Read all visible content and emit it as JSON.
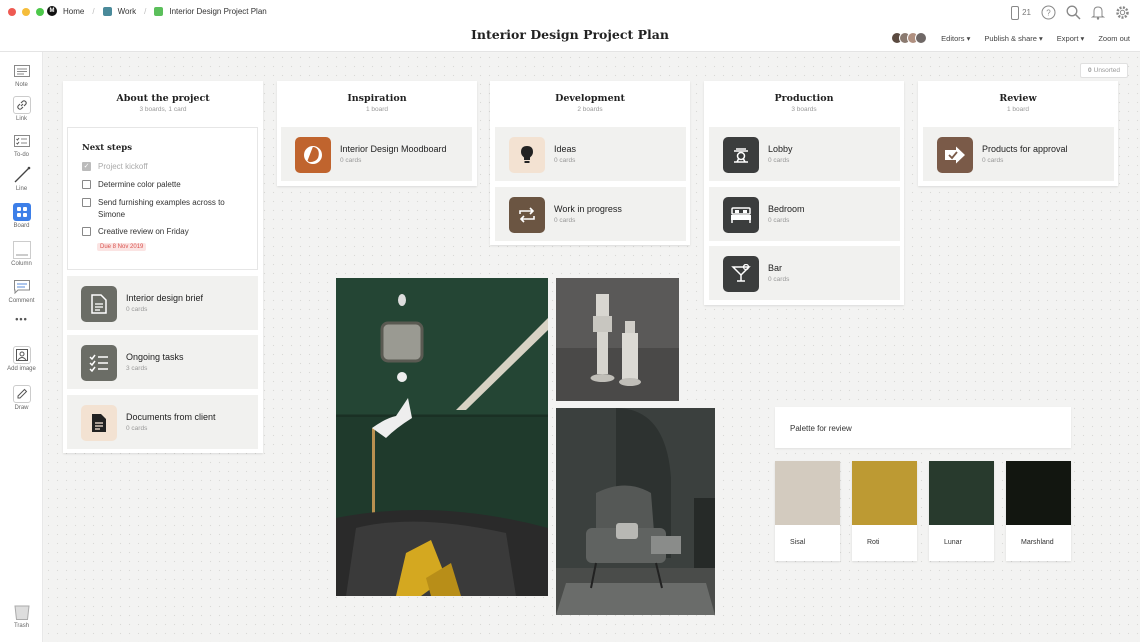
{
  "window": {
    "breadcrumbs": [
      {
        "label": "Home",
        "color": "#111111"
      },
      {
        "label": "Work",
        "color": "#4a8a9a"
      },
      {
        "label": "Interior Design Project Plan",
        "color": "#5bbf5b"
      }
    ],
    "title": "Interior Design Project Plan",
    "device_count": "21",
    "menu": {
      "editors": "Editors",
      "publish": "Publish & share",
      "export": "Export",
      "zoom": "Zoom out"
    }
  },
  "toolbar": {
    "note": "Note",
    "link": "Link",
    "todo": "To-do",
    "line": "Line",
    "board": "Board",
    "column": "Column",
    "comment": "Comment",
    "more": "•••",
    "add_image": "Add image",
    "draw": "Draw",
    "trash": "Trash"
  },
  "unsorted": {
    "count": "0",
    "label": "Unsorted"
  },
  "columns": {
    "about": {
      "title": "About the project",
      "subtitle": "3 boards, 1 card",
      "todo": {
        "title": "Next steps",
        "items": [
          {
            "text": "Project kickoff",
            "done": true
          },
          {
            "text": "Determine color palette",
            "done": false
          },
          {
            "text": "Send furnishing examples across to Simone",
            "done": false
          },
          {
            "text": "Creative review on Friday",
            "done": false
          }
        ],
        "due": "Due 8 Nov 2019"
      },
      "boards": [
        {
          "name": "Interior design brief",
          "count": "0 cards",
          "icon": "document-icon",
          "color": "#6b6d66"
        },
        {
          "name": "Ongoing tasks",
          "count": "3 cards",
          "icon": "checklist-icon",
          "color": "#6b6d66"
        },
        {
          "name": "Documents from client",
          "count": "0 cards",
          "icon": "file-text-icon",
          "color": "#f3e2d2"
        }
      ]
    },
    "inspiration": {
      "title": "Inspiration",
      "subtitle": "1 board",
      "boards": [
        {
          "name": "Interior Design Moodboard",
          "count": "0 cards",
          "icon": "moodboard-icon",
          "color": "#c0642e"
        }
      ]
    },
    "development": {
      "title": "Development",
      "subtitle": "2 boards",
      "boards": [
        {
          "name": "Ideas",
          "count": "0 cards",
          "icon": "lightbulb-icon",
          "color": "#f3e2d2"
        },
        {
          "name": "Work in progress",
          "count": "0 cards",
          "icon": "repeat-icon",
          "color": "#6b5542"
        }
      ]
    },
    "production": {
      "title": "Production",
      "subtitle": "3 boards",
      "boards": [
        {
          "name": "Lobby",
          "count": "0 cards",
          "icon": "lobby-icon",
          "color": "#3b3d3d"
        },
        {
          "name": "Bedroom",
          "count": "0 cards",
          "icon": "bed-icon",
          "color": "#3b3d3d"
        },
        {
          "name": "Bar",
          "count": "0 cards",
          "icon": "cocktail-icon",
          "color": "#3b3d3d"
        }
      ]
    },
    "review": {
      "title": "Review",
      "subtitle": "1 board",
      "boards": [
        {
          "name": "Products for approval",
          "count": "0 cards",
          "icon": "approve-arrow-icon",
          "color": "#7a5a48"
        }
      ]
    }
  },
  "palette": {
    "title": "Palette for review",
    "swatches": [
      {
        "name": "Sisal",
        "hex": "#d3cbbf"
      },
      {
        "name": "Roti",
        "hex": "#bd9a33"
      },
      {
        "name": "Lunar",
        "hex": "#283a2d"
      },
      {
        "name": "Marshland",
        "hex": "#121610"
      }
    ]
  }
}
